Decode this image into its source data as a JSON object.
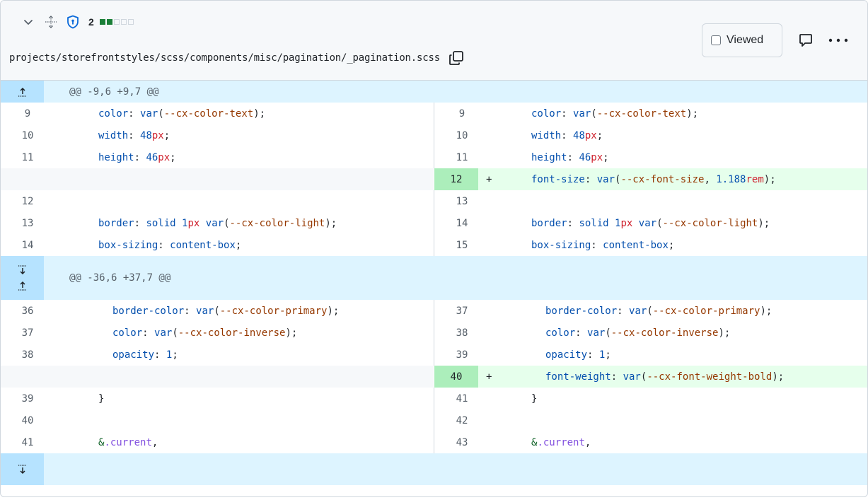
{
  "header": {
    "count": "2",
    "path": "projects/storefrontstyles/scss/components/misc/pagination/_pagination.scss",
    "viewed_label": "Viewed",
    "icons": {
      "collapse": "chevron-down-icon",
      "move": "move-icon",
      "security": "shield-icon",
      "copy": "copy-icon",
      "comment": "comment-icon",
      "more": "kebab-horizontal-icon"
    },
    "change_blocks": {
      "filled": 2,
      "total": 5
    }
  },
  "hunks": [
    {
      "header": "@@ -9,6 +9,7 @@",
      "rows": [
        {
          "ln": "9",
          "rn": "9",
          "tokens": [
            [
              "k",
              "color"
            ],
            [
              "p",
              ": "
            ],
            [
              "f",
              "var"
            ],
            [
              "p",
              "("
            ],
            [
              "s",
              "--cx-color-text"
            ],
            [
              "p",
              ");"
            ]
          ]
        },
        {
          "ln": "10",
          "rn": "10",
          "tokens": [
            [
              "k",
              "width"
            ],
            [
              "p",
              ": "
            ],
            [
              "n",
              "48"
            ],
            [
              "u",
              "px"
            ],
            [
              "p",
              ";"
            ]
          ]
        },
        {
          "ln": "11",
          "rn": "11",
          "tokens": [
            [
              "k",
              "height"
            ],
            [
              "p",
              ": "
            ],
            [
              "n",
              "46"
            ],
            [
              "u",
              "px"
            ],
            [
              "p",
              ";"
            ]
          ]
        },
        {
          "add": true,
          "rn": "12",
          "sign": "+",
          "tokens": [
            [
              "k",
              "font-size"
            ],
            [
              "p",
              ": "
            ],
            [
              "f",
              "var"
            ],
            [
              "p",
              "("
            ],
            [
              "s",
              "--cx-font-size"
            ],
            [
              "p",
              ", "
            ],
            [
              "n",
              "1.188"
            ],
            [
              "u",
              "rem"
            ],
            [
              "p",
              ");"
            ]
          ]
        },
        {
          "ln": "12",
          "rn": "13",
          "tokens": []
        },
        {
          "ln": "13",
          "rn": "14",
          "tokens": [
            [
              "k",
              "border"
            ],
            [
              "p",
              ": "
            ],
            [
              "k",
              "solid"
            ],
            [
              "p",
              " "
            ],
            [
              "n",
              "1"
            ],
            [
              "u",
              "px"
            ],
            [
              "p",
              " "
            ],
            [
              "f",
              "var"
            ],
            [
              "p",
              "("
            ],
            [
              "s",
              "--cx-color-light"
            ],
            [
              "p",
              ");"
            ]
          ]
        },
        {
          "ln": "14",
          "rn": "15",
          "tokens": [
            [
              "k",
              "box-sizing"
            ],
            [
              "p",
              ": "
            ],
            [
              "k",
              "content-box"
            ],
            [
              "p",
              ";"
            ]
          ]
        }
      ]
    },
    {
      "header": "@@ -36,6 +37,7 @@",
      "rows": [
        {
          "ln": "36",
          "rn": "37",
          "indent": 2,
          "tokens": [
            [
              "k",
              "border-color"
            ],
            [
              "p",
              ": "
            ],
            [
              "f",
              "var"
            ],
            [
              "p",
              "("
            ],
            [
              "s",
              "--cx-color-primary"
            ],
            [
              "p",
              ");"
            ]
          ]
        },
        {
          "ln": "37",
          "rn": "38",
          "indent": 2,
          "tokens": [
            [
              "k",
              "color"
            ],
            [
              "p",
              ": "
            ],
            [
              "f",
              "var"
            ],
            [
              "p",
              "("
            ],
            [
              "s",
              "--cx-color-inverse"
            ],
            [
              "p",
              ");"
            ]
          ]
        },
        {
          "ln": "38",
          "rn": "39",
          "indent": 2,
          "tokens": [
            [
              "k",
              "opacity"
            ],
            [
              "p",
              ": "
            ],
            [
              "n",
              "1"
            ],
            [
              "p",
              ";"
            ]
          ]
        },
        {
          "add": true,
          "rn": "40",
          "sign": "+",
          "indent": 2,
          "tokens": [
            [
              "k",
              "font-weight"
            ],
            [
              "p",
              ": "
            ],
            [
              "f",
              "var"
            ],
            [
              "p",
              "("
            ],
            [
              "s",
              "--cx-font-weight-bold"
            ],
            [
              "p",
              ");"
            ]
          ]
        },
        {
          "ln": "39",
          "rn": "41",
          "tokens": [
            [
              "p",
              "}"
            ]
          ]
        },
        {
          "ln": "40",
          "rn": "42",
          "tokens": []
        },
        {
          "ln": "41",
          "rn": "43",
          "tokens": [
            [
              "sel",
              "&"
            ],
            [
              "cls",
              ".current"
            ],
            [
              "p",
              ","
            ]
          ]
        }
      ]
    }
  ],
  "colors": {
    "hunk_bg": "#ddf4ff",
    "hunk_gutter": "#b6e3ff",
    "add_num_bg": "#aceebb",
    "add_code_bg": "#e6ffec",
    "progress_green": "#1a7f37"
  }
}
